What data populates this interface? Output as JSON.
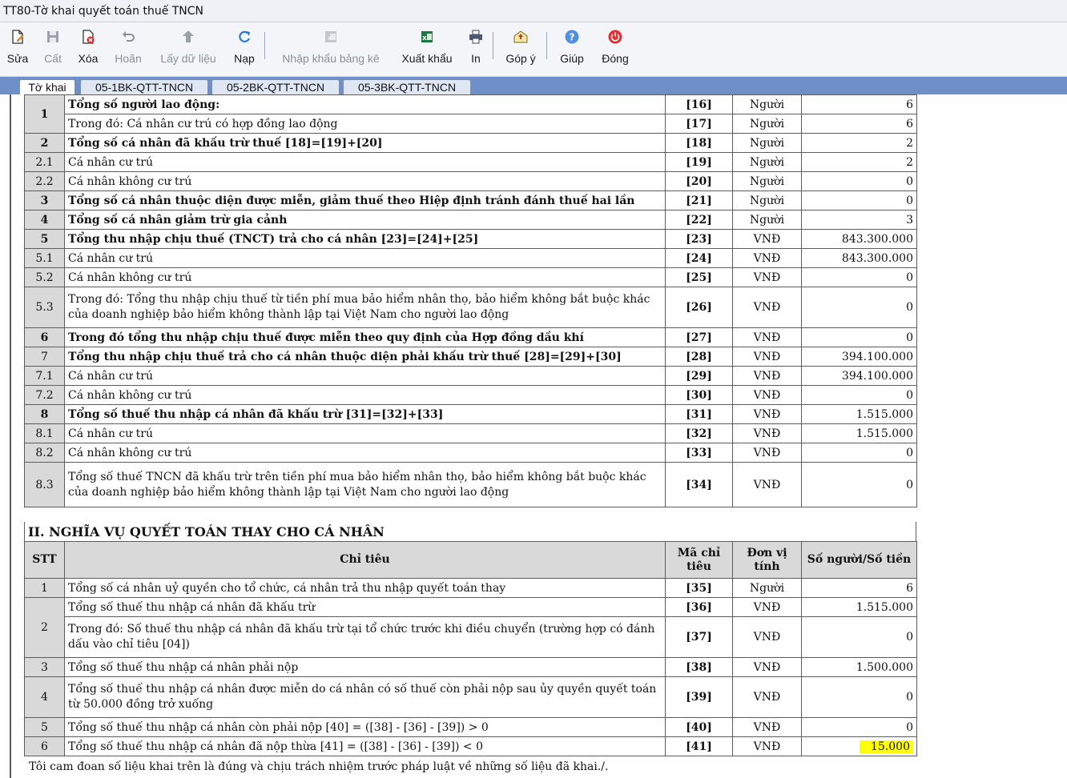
{
  "window": {
    "title": "TT80-Tờ khai quyết toán thuế TNCN"
  },
  "toolbar": {
    "buttons": [
      {
        "label": "Sửa",
        "icon": "edit-icon",
        "enabled": true
      },
      {
        "label": "Cất",
        "icon": "save-icon",
        "enabled": false
      },
      {
        "label": "Xóa",
        "icon": "delete-icon",
        "enabled": true
      },
      {
        "label": "Hoãn",
        "icon": "undo-icon",
        "enabled": false
      },
      {
        "label": "Lấy dữ liệu",
        "icon": "get-data-icon",
        "enabled": false
      },
      {
        "label": "Nạp",
        "icon": "reload-icon",
        "enabled": true
      },
      {
        "label": "Nhập khẩu bảng kê",
        "icon": "import-icon",
        "enabled": false
      },
      {
        "label": "Xuất khẩu",
        "icon": "excel-export-icon",
        "enabled": true
      },
      {
        "label": "In",
        "icon": "printer-icon",
        "enabled": true
      },
      {
        "label": "Góp ý",
        "icon": "feedback-icon",
        "enabled": true
      },
      {
        "label": "Giúp",
        "icon": "help-icon",
        "enabled": true
      },
      {
        "label": "Đóng",
        "icon": "power-icon",
        "enabled": true
      }
    ]
  },
  "tabs": [
    {
      "label": "Tờ khai",
      "active": true
    },
    {
      "label": "05-1BK-QTT-TNCN",
      "active": false
    },
    {
      "label": "05-2BK-QTT-TNCN",
      "active": false
    },
    {
      "label": "05-3BK-QTT-TNCN",
      "active": false
    }
  ],
  "section1": {
    "rows": [
      {
        "stt": "1",
        "desc": "Tổng số người lao động:",
        "code": "[16]",
        "unit": "Người",
        "value": "6"
      },
      {
        "stt": "",
        "desc": "Trong đó: Cá nhân cư trú có hợp đồng lao động",
        "code": "[17]",
        "unit": "Người",
        "value": "6"
      },
      {
        "stt": "2",
        "desc": "Tổng số cá nhân đã khấu trừ thuế [18]=[19]+[20]",
        "code": "[18]",
        "unit": "Người",
        "value": "2"
      },
      {
        "stt": "2.1",
        "desc": "Cá nhân cư trú",
        "code": "[19]",
        "unit": "Người",
        "value": "2"
      },
      {
        "stt": "2.2",
        "desc": "Cá nhân không cư trú",
        "code": "[20]",
        "unit": "Người",
        "value": "0"
      },
      {
        "stt": "3",
        "desc": "Tổng số cá nhân thuộc diện được miễn, giảm thuế theo Hiệp định tránh đánh thuế hai lần",
        "code": "[21]",
        "unit": "Người",
        "value": "0"
      },
      {
        "stt": "4",
        "desc": "Tổng số cá nhân giảm trừ gia cảnh",
        "code": "[22]",
        "unit": "Người",
        "value": "3"
      },
      {
        "stt": "5",
        "desc": "Tổng thu nhập chịu thuế (TNCT) trả cho cá nhân [23]=[24]+[25]",
        "code": "[23]",
        "unit": "VNĐ",
        "value": "843.300.000"
      },
      {
        "stt": "5.1",
        "desc": "Cá nhân cư trú",
        "code": "[24]",
        "unit": "VNĐ",
        "value": "843.300.000"
      },
      {
        "stt": "5.2",
        "desc": "Cá nhân không cư trú",
        "code": "[25]",
        "unit": "VNĐ",
        "value": "0"
      },
      {
        "stt": "5.3",
        "desc": "Trong đó: Tổng thu nhập chịu thuế từ tiền phí mua bảo hiểm nhân thọ, bảo hiểm không bắt buộc khác của doanh nghiệp bảo hiểm không thành lập tại Việt Nam cho người lao động",
        "code": "[26]",
        "unit": "VNĐ",
        "value": "0"
      },
      {
        "stt": "6",
        "desc": "Trong đó tổng thu nhập chịu thuế được miễn theo quy định của Hợp đồng dầu khí",
        "code": "[27]",
        "unit": "VNĐ",
        "value": "0"
      },
      {
        "stt": "7",
        "desc": "Tổng thu nhập chịu thuế trả cho cá nhân thuộc diện phải khấu trừ thuế [28]=[29]+[30]",
        "code": "[28]",
        "unit": "VNĐ",
        "value": "394.100.000"
      },
      {
        "stt": "7.1",
        "desc": "Cá nhân cư trú",
        "code": "[29]",
        "unit": "VNĐ",
        "value": "394.100.000"
      },
      {
        "stt": "7.2",
        "desc": "Cá nhân không cư trú",
        "code": "[30]",
        "unit": "VNĐ",
        "value": "0"
      },
      {
        "stt": "8",
        "desc": "Tổng số thuế thu nhập cá nhân đã khấu trừ [31]=[32]+[33]",
        "code": "[31]",
        "unit": "VNĐ",
        "value": "1.515.000"
      },
      {
        "stt": "8.1",
        "desc": "Cá nhân cư trú",
        "code": "[32]",
        "unit": "VNĐ",
        "value": "1.515.000"
      },
      {
        "stt": "8.2",
        "desc": "Cá nhân không cư trú",
        "code": "[33]",
        "unit": "VNĐ",
        "value": "0"
      },
      {
        "stt": "8.3",
        "desc": "Tổng số thuế TNCN đã khấu trừ trên tiền phí mua bảo hiểm nhân thọ, bảo hiểm không bắt buộc khác của doanh nghiệp bảo hiểm không thành lập tại Việt Nam cho người lao động",
        "code": "[34]",
        "unit": "VNĐ",
        "value": "0"
      }
    ]
  },
  "section2": {
    "title": "II. NGHĨA VỤ QUYẾT TOÁN THAY CHO CÁ NHÂN",
    "headers": {
      "stt": "STT",
      "desc": "Chỉ tiêu",
      "code": "Mã chỉ tiêu",
      "unit": "Đơn vị tính",
      "value": "Số người/Số tiền"
    },
    "rows": [
      {
        "stt": "1",
        "desc": "Tổng số cá nhân uỷ quyền cho tổ chức, cá nhân trả thu nhập quyết toán thay",
        "code": "[35]",
        "unit": "Người",
        "value": "6"
      },
      {
        "stt": "2",
        "desc": "Tổng số thuế thu nhập cá nhân đã khấu trừ",
        "code": "[36]",
        "unit": "VNĐ",
        "value": "1.515.000"
      },
      {
        "stt": "",
        "desc": "Trong đó: Số thuế thu nhập cá nhân đã khấu trừ tại tổ chức trước khi điều chuyển (trường hợp có đánh dấu vào chỉ tiêu [04])",
        "code": "[37]",
        "unit": "VNĐ",
        "value": "0"
      },
      {
        "stt": "3",
        "desc": "Tổng số thuế thu nhập cá nhân phải nộp",
        "code": "[38]",
        "unit": "VNĐ",
        "value": "1.500.000"
      },
      {
        "stt": "4",
        "desc": "Tổng số thuế thu nhập cá nhân được miễn do cá nhân có số thuế còn phải nộp sau ủy quyền quyết toán từ 50.000 đồng trở xuống",
        "code": "[39]",
        "unit": "VNĐ",
        "value": "0"
      },
      {
        "stt": "5",
        "desc": "Tổng số thuế thu nhập cá nhân còn phải nộp [40] = ([38] - [36] - [39]) > 0",
        "code": "[40]",
        "unit": "VNĐ",
        "value": "0"
      },
      {
        "stt": "6",
        "desc": "Tổng số thuế thu nhập cá nhân đã nộp thừa [41] = ([38] - [36] - [39]) < 0",
        "code": "[41]",
        "unit": "VNĐ",
        "value": "15.000"
      }
    ]
  },
  "footer": {
    "text": "Tôi cam đoan số liệu khai trên là đúng và chịu trách nhiệm trước pháp luật về những số liệu đã khai./."
  }
}
